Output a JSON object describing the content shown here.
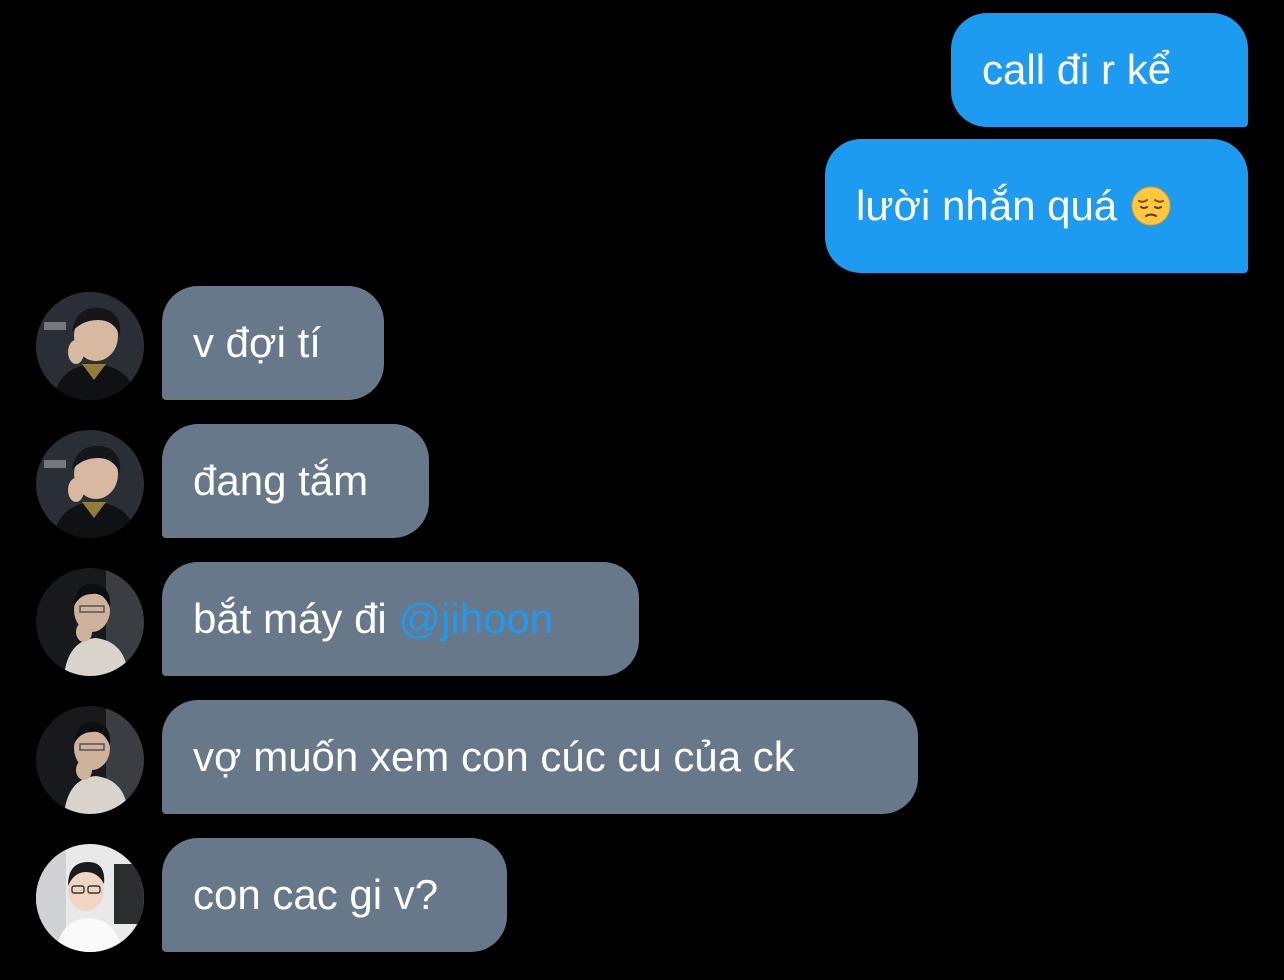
{
  "colors": {
    "background": "#000000",
    "outgoing_bubble": "#1d9bf0",
    "incoming_bubble": "#67788a",
    "mention": "#1d9bf0"
  },
  "messages": [
    {
      "direction": "out",
      "text": "call đi r kể"
    },
    {
      "direction": "out",
      "text": "lười nhắn quá",
      "emoji": "pensive-face-emoji"
    },
    {
      "direction": "in",
      "avatar": "avatar-user-1",
      "text": "v đợi tí"
    },
    {
      "direction": "in",
      "avatar": "avatar-user-1",
      "text": "đang tắm"
    },
    {
      "direction": "in",
      "avatar": "avatar-user-2",
      "text": "bắt máy đi ",
      "mention": "@jihoon"
    },
    {
      "direction": "in",
      "avatar": "avatar-user-2",
      "text": "vợ muốn xem con cúc cu của ck"
    },
    {
      "direction": "in",
      "avatar": "avatar-user-3",
      "text": "con cac gi v?"
    }
  ]
}
